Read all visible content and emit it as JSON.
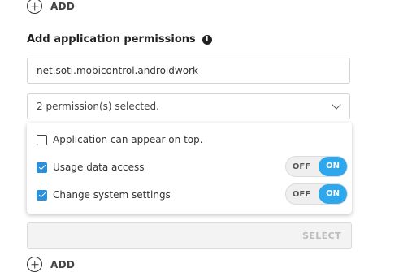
{
  "add_top": {
    "label": "ADD",
    "icon": "plus-circle-icon"
  },
  "section": {
    "title": "Add application permissions",
    "info_icon": "info-icon",
    "info_glyph": "i"
  },
  "package_field": {
    "value": "net.soti.mobicontrol.androidwork"
  },
  "permissions_dropdown": {
    "value": "2 permission(s) selected.",
    "icon": "chevron-down-icon"
  },
  "permissions": [
    {
      "label": "Application can appear on top.",
      "checked": false
    },
    {
      "label": "Usage data access",
      "checked": true,
      "toggle_off": "OFF",
      "toggle_on": "ON",
      "state": "ON"
    },
    {
      "label": "Change system settings",
      "checked": true,
      "toggle_off": "OFF",
      "toggle_on": "ON",
      "state": "ON"
    }
  ],
  "select_bar": {
    "button": "SELECT"
  },
  "add_bottom": {
    "label": "ADD",
    "icon": "plus-circle-icon"
  },
  "colors": {
    "accent": "#2ea7ec",
    "checkbox": "#2c8fd9"
  }
}
